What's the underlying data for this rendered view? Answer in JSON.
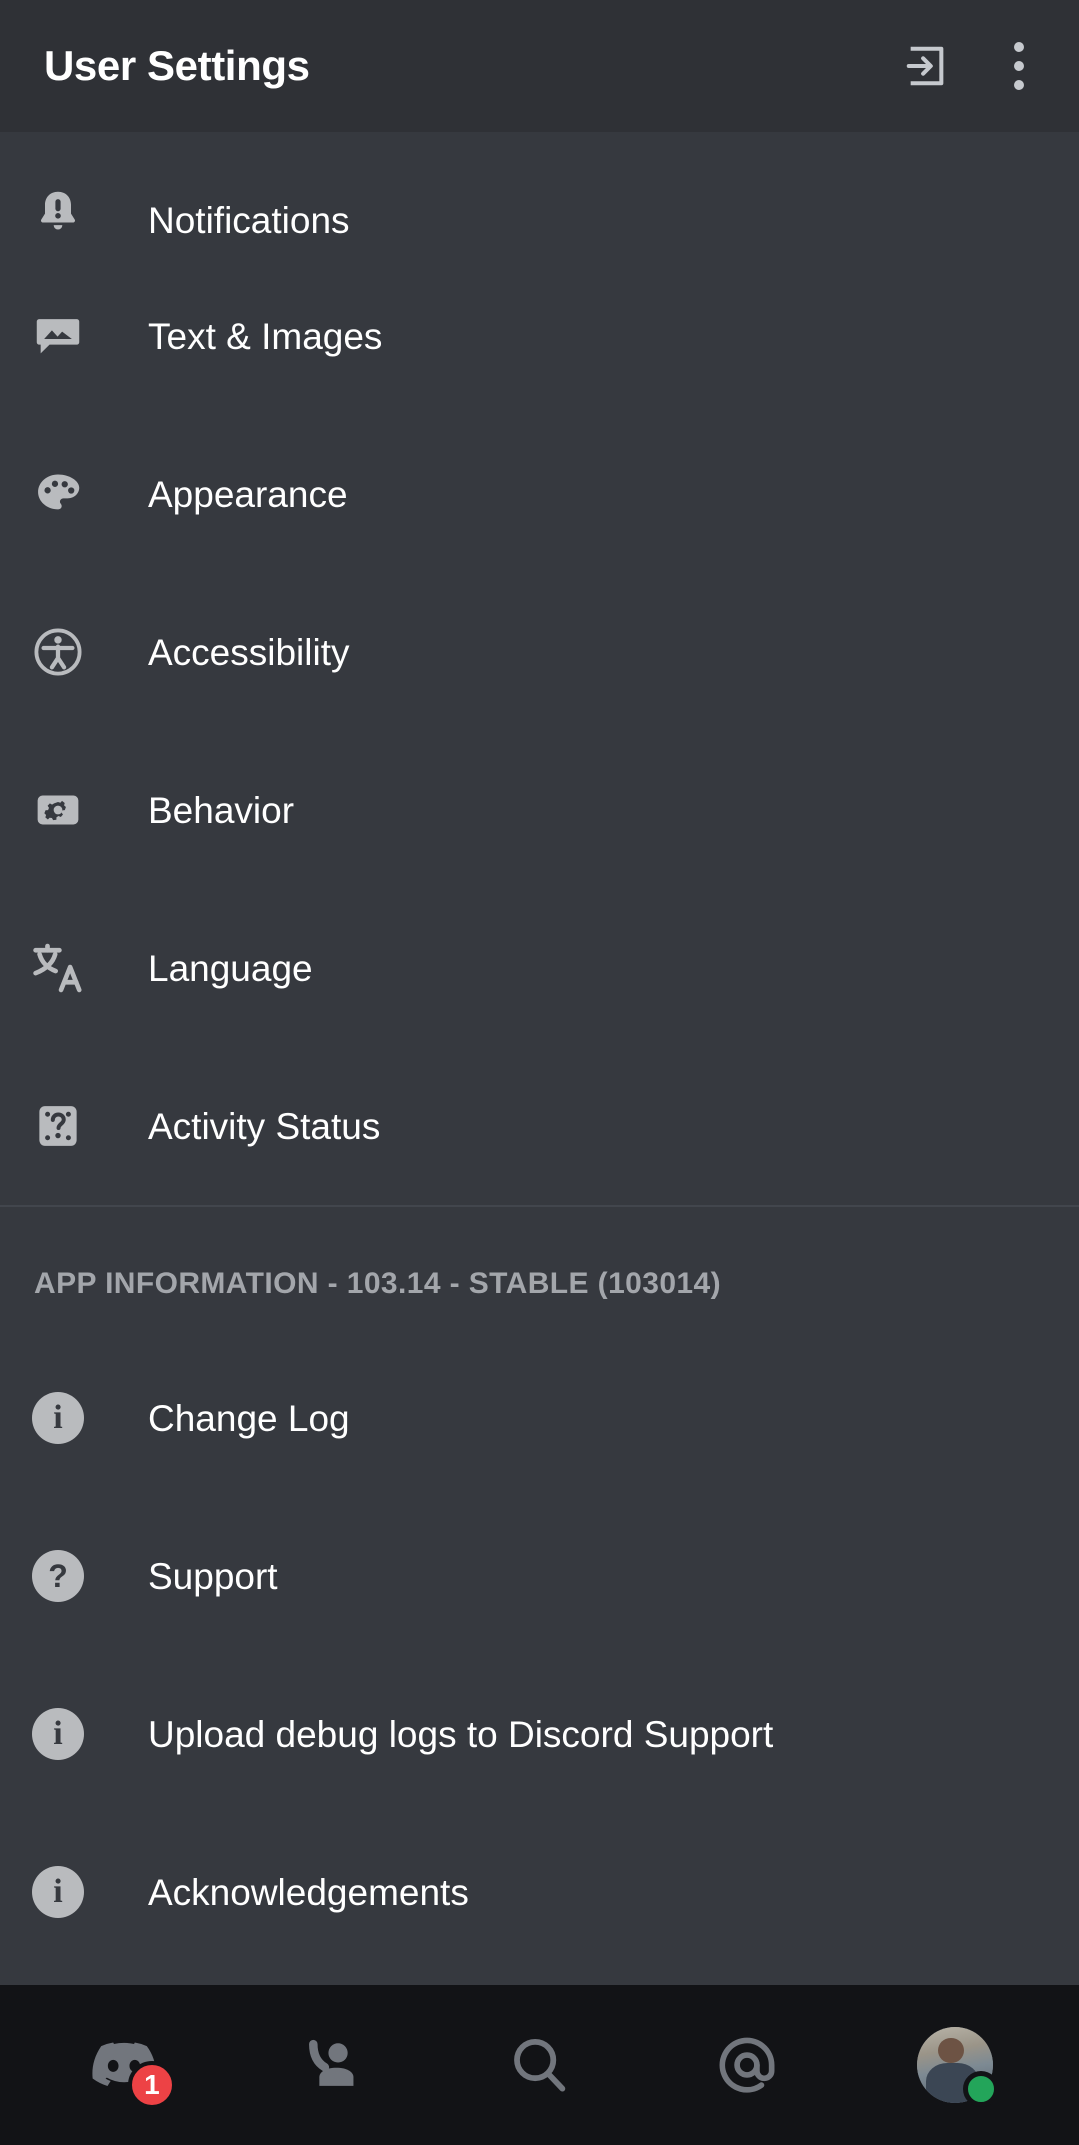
{
  "header": {
    "title": "User Settings",
    "logout_icon": "logout-icon",
    "overflow_icon": "more-vertical-icon"
  },
  "settings": {
    "items": [
      {
        "label": "Notifications",
        "icon": "bell-alert-icon"
      },
      {
        "label": "Text & Images",
        "icon": "image-message-icon"
      },
      {
        "label": "Appearance",
        "icon": "palette-icon"
      },
      {
        "label": "Accessibility",
        "icon": "accessibility-icon"
      },
      {
        "label": "Behavior",
        "icon": "gear-square-icon"
      },
      {
        "label": "Language",
        "icon": "translate-icon"
      },
      {
        "label": "Activity Status",
        "icon": "game-controller-icon"
      }
    ]
  },
  "app_information": {
    "section_label": "APP INFORMATION - 103.14 - STABLE (103014)",
    "version": "103.14",
    "release_channel": "STABLE",
    "build": "103014",
    "items": [
      {
        "label": "Change Log",
        "icon": "info-circle-icon",
        "glyph": "i"
      },
      {
        "label": "Support",
        "icon": "question-circle-icon",
        "glyph": "?"
      },
      {
        "label": "Upload debug logs to Discord Support",
        "icon": "info-circle-icon",
        "glyph": "i"
      },
      {
        "label": "Acknowledgements",
        "icon": "info-circle-icon",
        "glyph": "i"
      }
    ]
  },
  "bottom_nav": {
    "items": [
      {
        "name": "servers",
        "icon": "discord-logo-icon",
        "badge": "1"
      },
      {
        "name": "friends",
        "icon": "friends-icon",
        "badge": ""
      },
      {
        "name": "search",
        "icon": "search-icon",
        "badge": ""
      },
      {
        "name": "mentions",
        "icon": "mention-at-icon",
        "badge": ""
      },
      {
        "name": "profile",
        "icon": "avatar-icon",
        "badge": ""
      }
    ],
    "status": "online"
  },
  "colors": {
    "header_bg": "#2f3136",
    "body_bg": "#36393f",
    "nav_bg": "#121316",
    "icon_gray": "#b9bbbe",
    "text_white": "#ffffff",
    "muted": "#a3a6ab",
    "badge_red": "#ed4245",
    "status_green": "#23a55a"
  }
}
